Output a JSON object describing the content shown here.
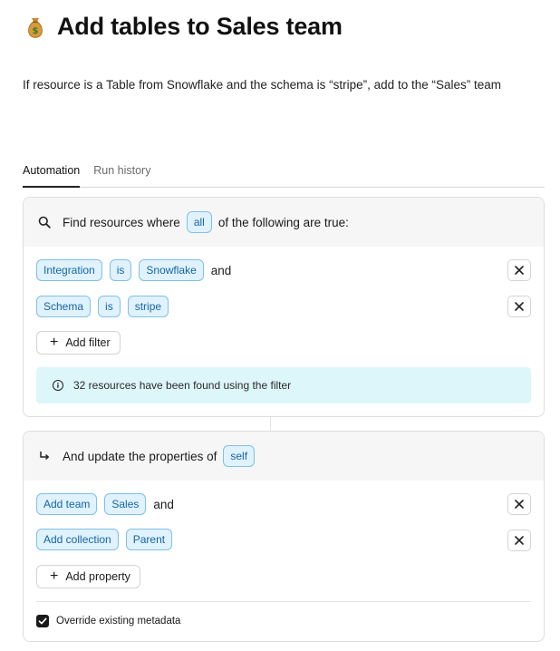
{
  "header": {
    "title": "Add tables to Sales team",
    "emoji": "money-bag-icon",
    "description": "If resource is a Table from Snowflake and the schema is “stripe”, add to the “Sales” team"
  },
  "tabs": [
    {
      "label": "Automation",
      "active": true
    },
    {
      "label": "Run history",
      "active": false
    }
  ],
  "filter_card": {
    "prefix": "Find resources where",
    "quantifier": "all",
    "suffix": "of the following are true:",
    "rows": [
      {
        "field": "Integration",
        "operator": "is",
        "value": "Snowflake",
        "connector": "and"
      },
      {
        "field": "Schema",
        "operator": "is",
        "value": "stripe",
        "connector": ""
      }
    ],
    "add_label": "Add filter",
    "info_text": "32 resources have been found using the filter"
  },
  "update_card": {
    "prefix": "And update the properties of",
    "target": "self",
    "rows": [
      {
        "action": "Add team",
        "value": "Sales",
        "connector": "and"
      },
      {
        "action": "Add collection",
        "value": "Parent",
        "connector": ""
      }
    ],
    "add_label": "Add property",
    "override_label": "Override existing metadata",
    "override_checked": true
  },
  "colors": {
    "chip_bg": "#dff2fd",
    "chip_border": "#7fc1e8",
    "chip_text": "#1565a8",
    "info_bg": "#dcf6fa"
  }
}
